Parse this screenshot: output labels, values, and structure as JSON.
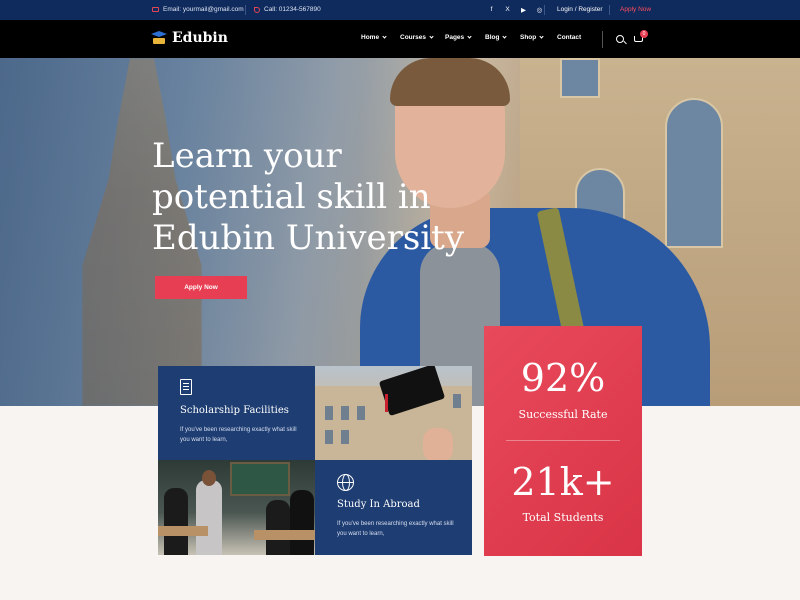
{
  "topbar": {
    "email": "Email: yourmail@gmail.com",
    "phone": "Call: 01234-567890",
    "social": [
      "f",
      "X",
      "▶",
      "◎"
    ],
    "login": "Login / Register",
    "apply": "Apply Now"
  },
  "nav": {
    "logo": "Edubin",
    "items": [
      {
        "label": "Home",
        "has_dropdown": true
      },
      {
        "label": "Courses",
        "has_dropdown": true
      },
      {
        "label": "Pages",
        "has_dropdown": true
      },
      {
        "label": "Blog",
        "has_dropdown": true
      },
      {
        "label": "Shop",
        "has_dropdown": true
      },
      {
        "label": "Contact",
        "has_dropdown": false
      }
    ],
    "cart_count": "0"
  },
  "hero": {
    "title_line1": "Learn your",
    "title_line2": "potential skill in",
    "title_line3": "Edubin University",
    "button": "Apply Now"
  },
  "features": {
    "scholarship": {
      "title": "Scholarship Facilities",
      "text": "If you've been researching exactly what skill you want to learn,"
    },
    "abroad": {
      "title": "Study In Abroad",
      "text": "If you've been researching exactly what skill you want to learn,"
    }
  },
  "stats": {
    "rate_value": "92%",
    "rate_label": "Successful Rate",
    "students_value": "21k+",
    "students_label": "Total Students"
  },
  "colors": {
    "navy": "#0f2a5c",
    "accent": "#e83e53",
    "card_navy": "#1e3d72"
  }
}
